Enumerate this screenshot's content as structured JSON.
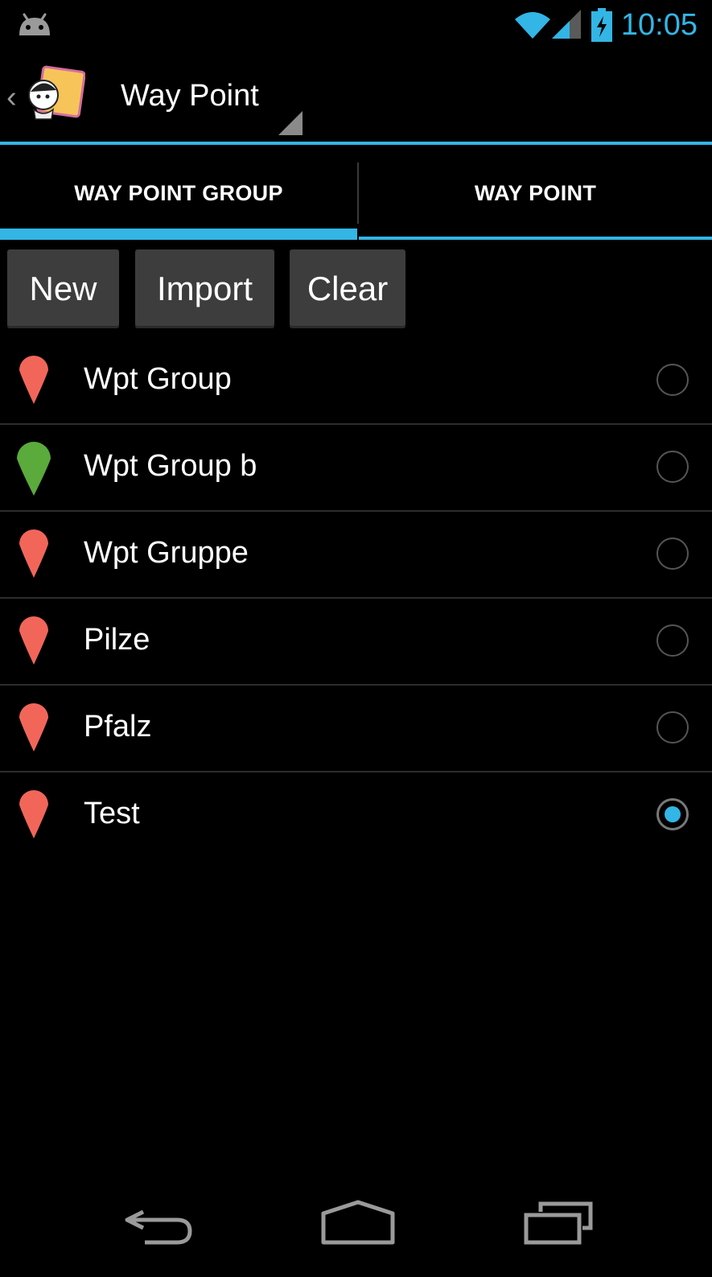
{
  "status_bar": {
    "time": "10:05",
    "icons": [
      "android-icon",
      "wifi-icon",
      "signal-icon",
      "battery-charging-icon"
    ]
  },
  "action_bar": {
    "title": "Way Point",
    "icons": [
      "up-caret-icon",
      "app-logo-icon",
      "spinner-corner-icon"
    ]
  },
  "tabs": [
    {
      "label": "WAY POINT GROUP",
      "selected": true
    },
    {
      "label": "WAY POINT",
      "selected": false
    }
  ],
  "buttons": {
    "new_label": "New",
    "import_label": "Import",
    "clear_label": "Clear"
  },
  "groups": [
    {
      "name": "Wpt Group",
      "pin_color": "#f2665a",
      "selected": false
    },
    {
      "name": "Wpt Group b",
      "pin_color": "#5aaa3c",
      "selected": false
    },
    {
      "name": "Wpt Gruppe",
      "pin_color": "#f2665a",
      "selected": false
    },
    {
      "name": "Pilze",
      "pin_color": "#f2665a",
      "selected": false
    },
    {
      "name": "Pfalz",
      "pin_color": "#f2665a",
      "selected": false
    },
    {
      "name": "Test",
      "pin_color": "#f2665a",
      "selected": true
    }
  ],
  "nav_bar": {
    "icons": [
      "back-icon",
      "home-icon",
      "recent-apps-icon"
    ]
  },
  "colors": {
    "accent": "#33b5e5",
    "background": "#000000",
    "button": "#3d3d3d"
  }
}
